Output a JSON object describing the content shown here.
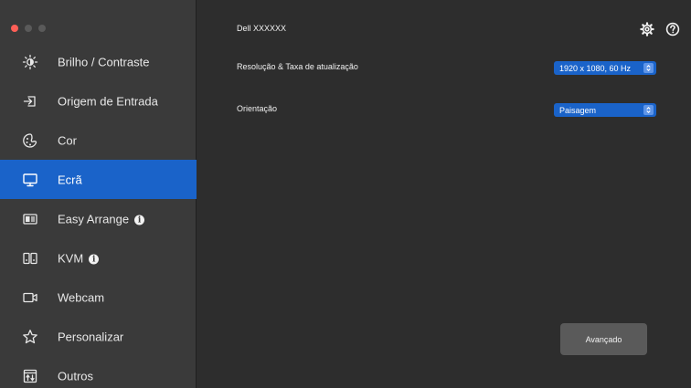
{
  "window": {
    "controls": [
      "close",
      "minimize",
      "zoom"
    ]
  },
  "header": {
    "title": "Dell XXXXXX",
    "settings_icon": "gear-icon",
    "help_icon": "question-mark-icon"
  },
  "sidebar": {
    "active_index": 3,
    "items": [
      {
        "label": "Brilho / Contraste",
        "icon": "brightness-icon"
      },
      {
        "label": "Origem de Entrada",
        "icon": "input-source-icon"
      },
      {
        "label": "Cor",
        "icon": "color-icon"
      },
      {
        "label": "Ecrã",
        "icon": "display-icon"
      },
      {
        "label": "Easy Arrange",
        "icon": "easy-arrange-icon",
        "info": "i"
      },
      {
        "label": "KVM",
        "icon": "kvm-icon",
        "info": "i"
      },
      {
        "label": "Webcam",
        "icon": "webcam-icon"
      },
      {
        "label": "Personalizar",
        "icon": "star-icon"
      },
      {
        "label": "Outros",
        "icon": "others-icon"
      }
    ]
  },
  "main": {
    "resolution": {
      "label": "Resolução & Taxa de atualização",
      "value": "1920 x 1080, 60 Hz"
    },
    "orientation": {
      "label": "Orientação",
      "value": "Paisagem"
    },
    "advanced_button": "Avançado"
  },
  "colors": {
    "accent": "#1a63c9",
    "sidebar_bg": "#3a3a3a",
    "main_bg": "#2d2d2d",
    "close_dot": "#ff5f57"
  }
}
